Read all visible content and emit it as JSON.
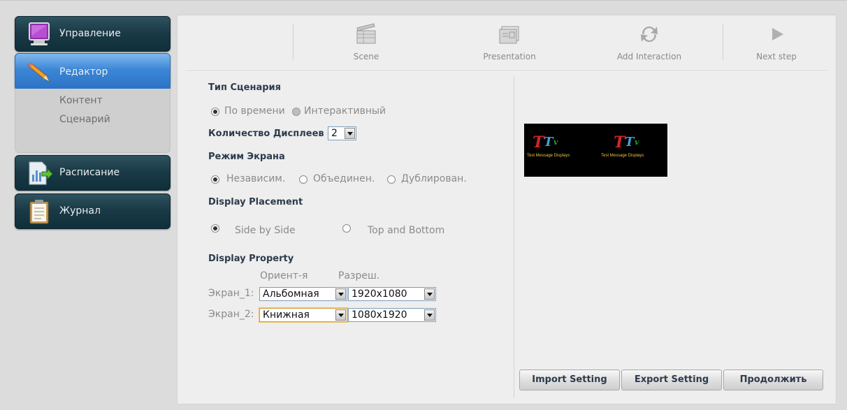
{
  "sidebar": {
    "items": [
      {
        "label": "Управление",
        "icon": "monitor-icon"
      },
      {
        "label": "Редактор",
        "icon": "pencil-icon"
      },
      {
        "label": "Расписание",
        "icon": "schedule-chart-icon"
      },
      {
        "label": "Журнал",
        "icon": "clipboard-icon"
      }
    ],
    "submenu": [
      "Контент",
      "Сценарий"
    ]
  },
  "toolbar": {
    "items": [
      {
        "label": "Scene",
        "icon": "clapperboard-icon"
      },
      {
        "label": "Presentation",
        "icon": "presentation-icon"
      },
      {
        "label": "Add Interaction",
        "icon": "refresh-arrows-icon"
      },
      {
        "label": "Next step",
        "icon": "play-arrow-icon"
      }
    ]
  },
  "scenario": {
    "title": "Тип Сценария",
    "options": [
      "По времени",
      "Интерактивный"
    ],
    "selected": "По времени"
  },
  "displays": {
    "label": "Количество Дисплеев",
    "value": "2"
  },
  "screen_mode": {
    "title": "Режим Экрана",
    "options": [
      "Независим.",
      "Объединен.",
      "Дублирован."
    ],
    "selected": "Независим."
  },
  "placement": {
    "title": "Display Placement",
    "options": [
      "Side by Side",
      "Top and Bottom"
    ],
    "selected": "Side by Side"
  },
  "property": {
    "title": "Display Property",
    "col_orientation": "Ориент-я",
    "col_resolution": "Разреш.",
    "rows": [
      {
        "label": "Экран_1:",
        "orientation": "Альбомная",
        "resolution": "1920x1080"
      },
      {
        "label": "Экран_2:",
        "orientation": "Книжная",
        "resolution": "1080x1920"
      }
    ]
  },
  "preview": {
    "logo_big": "T",
    "logo_mid": "T",
    "logo_suffix": "v",
    "logo_caption": "Test Message Displays"
  },
  "buttons": {
    "import": "Import Setting",
    "export": "Export Setting",
    "continue": "Продолжить"
  },
  "colors": {
    "nav_dark": "#1a3a46",
    "nav_active": "#3b85d6",
    "section_title": "#2d3b4c"
  }
}
